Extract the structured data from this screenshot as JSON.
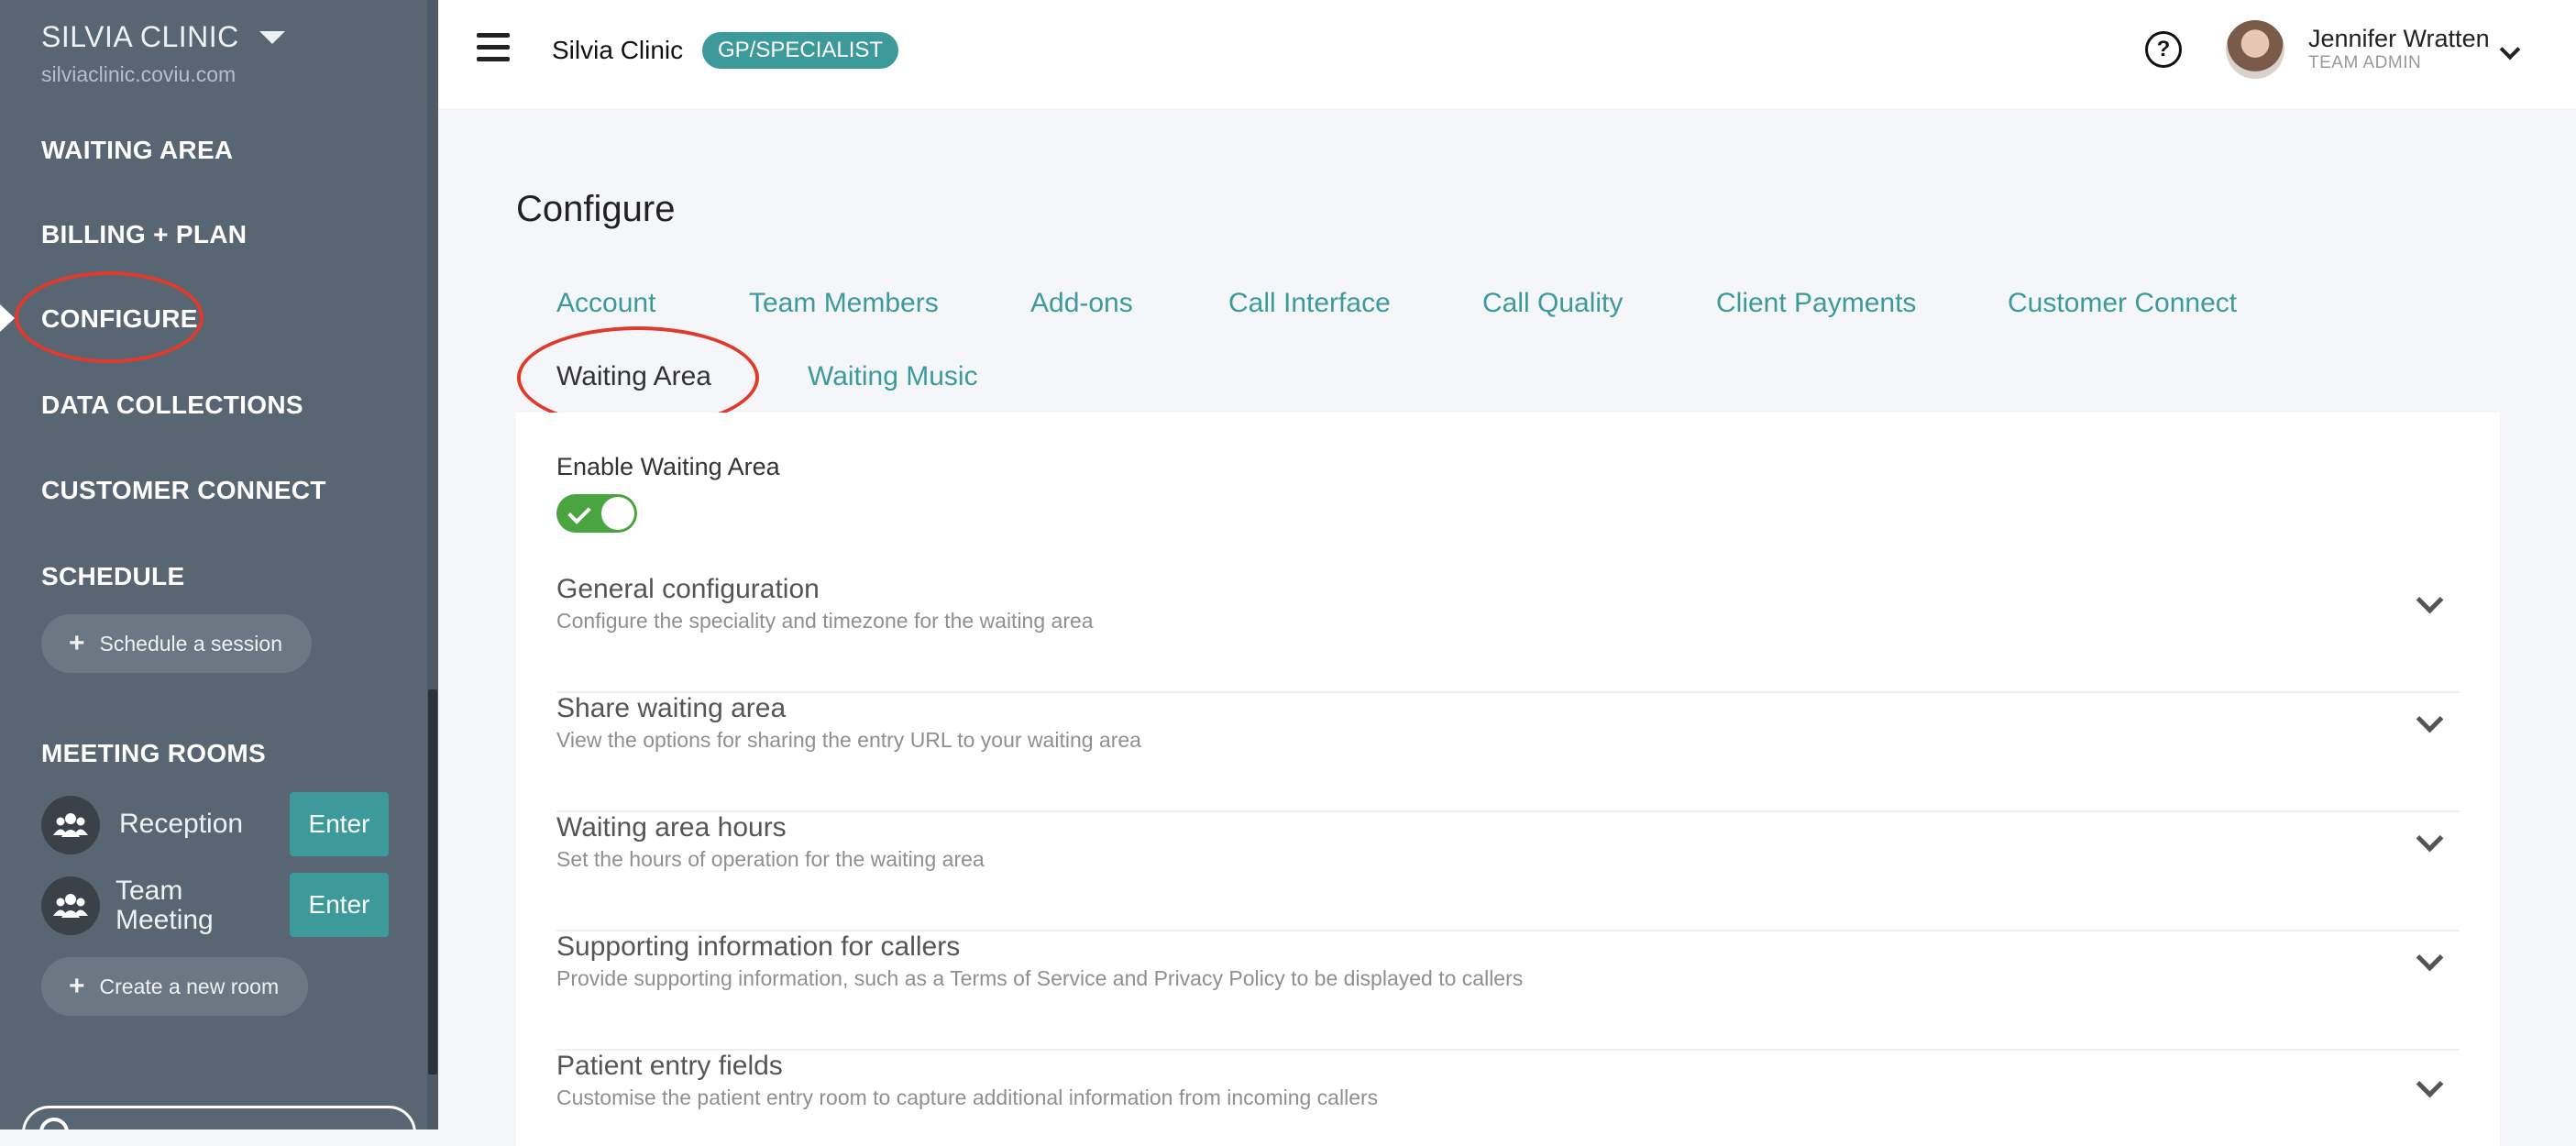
{
  "sidebar": {
    "clinic_name": "SILVIA CLINIC",
    "clinic_url": "silviaclinic.coviu.com",
    "nav": {
      "waiting_area": "WAITING AREA",
      "billing_plan": "BILLING + PLAN",
      "configure": "CONFIGURE",
      "data_collections": "DATA COLLECTIONS",
      "customer_connect": "CUSTOMER CONNECT",
      "schedule": "SCHEDULE",
      "meeting_rooms": "MEETING ROOMS"
    },
    "schedule_button": "Schedule a session",
    "rooms": [
      {
        "name": "Reception",
        "enter_label": "Enter"
      },
      {
        "name_line1": "Team",
        "name_line2": "Meeting",
        "enter_label": "Enter"
      }
    ],
    "create_room_button": "Create a new room"
  },
  "header": {
    "org_name": "Silvia Clinic",
    "org_badge": "GP/SPECIALIST",
    "help_symbol": "?",
    "user_name": "Jennifer Wratten",
    "user_role": "TEAM ADMIN"
  },
  "main": {
    "title": "Configure",
    "tabs": [
      {
        "label": "Account"
      },
      {
        "label": "Team Members"
      },
      {
        "label": "Add-ons"
      },
      {
        "label": "Call Interface"
      },
      {
        "label": "Call Quality"
      },
      {
        "label": "Client Payments"
      },
      {
        "label": "Customer Connect"
      },
      {
        "label": "Waiting Area",
        "active": true
      },
      {
        "label": "Waiting Music"
      }
    ],
    "enable_label": "Enable Waiting Area",
    "enable_on": true,
    "sections": [
      {
        "title": "General configuration",
        "desc": "Configure the speciality and timezone for the waiting area"
      },
      {
        "title": "Share waiting area",
        "desc": "View the options for sharing the entry URL to your waiting area"
      },
      {
        "title": "Waiting area hours",
        "desc": "Set the hours of operation for the waiting area"
      },
      {
        "title": "Supporting information for callers",
        "desc": "Provide supporting information, such as a Terms of Service and Privacy Policy to be displayed to callers"
      },
      {
        "title": "Patient entry fields",
        "desc": "Customise the patient entry room to capture additional information from incoming callers"
      }
    ]
  },
  "colors": {
    "sidebar_bg": "#586573",
    "accent_teal": "#3d9a9b",
    "toggle_green": "#4aa43f",
    "annotation_red": "#e03a2c"
  }
}
